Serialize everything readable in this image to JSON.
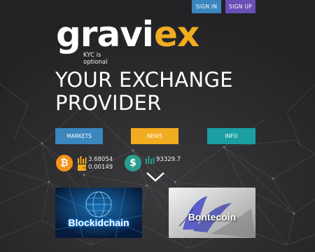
{
  "header": {
    "signin_label": "SIGN IN",
    "signup_label": "SIGN UP"
  },
  "brand": {
    "logo_prefix": "gravi",
    "logo_suffix": "ex",
    "tagline": "KYC is optional"
  },
  "hero": {
    "line1": "YOUR EXCHANGE",
    "line2": "PROVIDER"
  },
  "nav": {
    "markets_label": "MARKETS",
    "news_label": "NEWS",
    "info_label": "INFO"
  },
  "stats": {
    "btc": {
      "icon": "bitcoin-icon",
      "volume": "3.68054",
      "price": "0.00149"
    },
    "usd": {
      "icon": "dollar-icon",
      "volume": "93329.7"
    }
  },
  "cards": [
    {
      "title": "Blockidchain"
    },
    {
      "title": "Bontecoin"
    }
  ],
  "colors": {
    "blue": "#3a86bf",
    "purple": "#6a4fb6",
    "orange": "#f2ac20",
    "teal": "#1b9fa3",
    "btc_orange": "#f7931a",
    "background": "#2a2a2c"
  }
}
